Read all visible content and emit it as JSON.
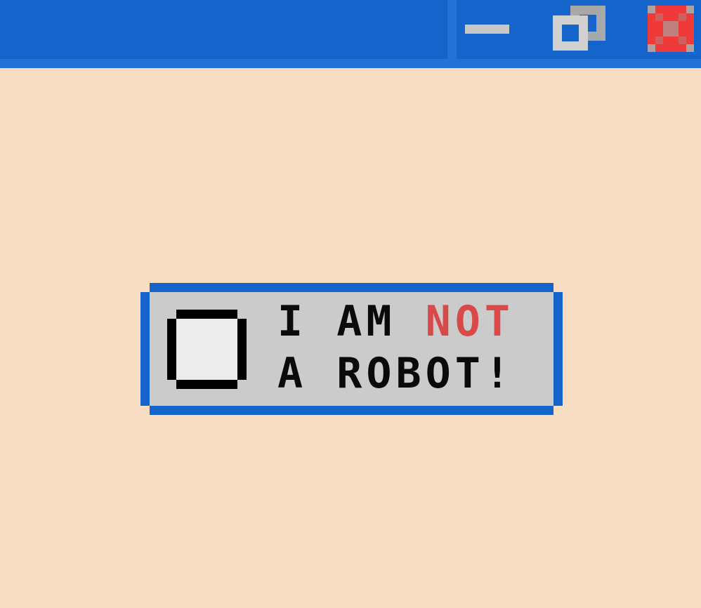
{
  "window": {
    "controls": {
      "minimize_icon": "minimize-icon",
      "restore_icon": "restore-icon",
      "close_icon": "close-icon"
    },
    "colors": {
      "titlebar": "#1464cc",
      "titlebar_highlight": "#2472d8",
      "background": "#f7ddc2"
    }
  },
  "captcha": {
    "line1_prefix": "i AM",
    "line1_highlight": "NOT",
    "line2": "A robot!",
    "checked": false,
    "colors": {
      "border": "#1464cc",
      "panel": "#cbcbcb",
      "text": "#0a0a0a",
      "highlight": "#d84a4a",
      "checkbox_fill": "#ececec"
    }
  }
}
